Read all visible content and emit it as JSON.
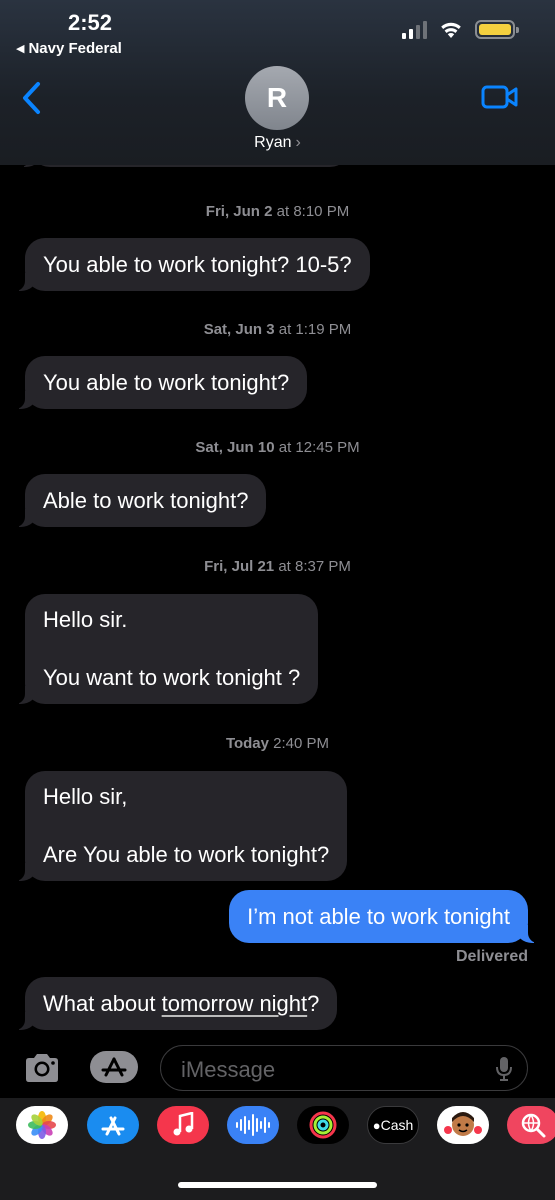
{
  "status_bar": {
    "time": "2:52",
    "back_app": "Navy Federal"
  },
  "header": {
    "avatar_initial": "R",
    "contact_name": "Ryan"
  },
  "messages": [
    {
      "type": "timestamp",
      "day": "Fri, Jun 2",
      "time": "at 8:10 PM"
    },
    {
      "type": "received",
      "lines": [
        "You able to work tonight? 10-5?"
      ]
    },
    {
      "type": "timestamp",
      "day": "Sat, Jun 3",
      "time": "at 1:19 PM"
    },
    {
      "type": "received",
      "lines": [
        "You able to work tonight?"
      ]
    },
    {
      "type": "timestamp",
      "day": "Sat, Jun 10",
      "time": "at 12:45 PM"
    },
    {
      "type": "received",
      "lines": [
        "Able to work tonight?"
      ]
    },
    {
      "type": "timestamp",
      "day": "Fri, Jul 21",
      "time": "at 8:37 PM"
    },
    {
      "type": "received",
      "lines": [
        "Hello sir.",
        "You want to work tonight ?"
      ]
    },
    {
      "type": "timestamp",
      "day": "Today",
      "time": "2:40 PM"
    },
    {
      "type": "received",
      "lines": [
        "Hello sir,",
        "Are You able to work tonight?"
      ]
    },
    {
      "type": "sent",
      "lines": [
        "I’m not able to work tonight"
      ]
    },
    {
      "type": "received",
      "prefix": "What about ",
      "link": "tomorrow night",
      "suffix": "?"
    }
  ],
  "delivered_label": "Delivered",
  "input": {
    "placeholder": "iMessage"
  },
  "app_drawer": [
    {
      "name": "photos-icon"
    },
    {
      "name": "app-store-icon"
    },
    {
      "name": "music-icon"
    },
    {
      "name": "audio-message-icon"
    },
    {
      "name": "fitness-icon"
    },
    {
      "name": "apple-cash-icon",
      "label": "Cash"
    },
    {
      "name": "memoji-icon"
    },
    {
      "name": "web-search-icon"
    }
  ],
  "colors": {
    "sent_bubble": "#3a82f6",
    "received_bubble": "#26252a",
    "accent": "#0a84ff"
  }
}
